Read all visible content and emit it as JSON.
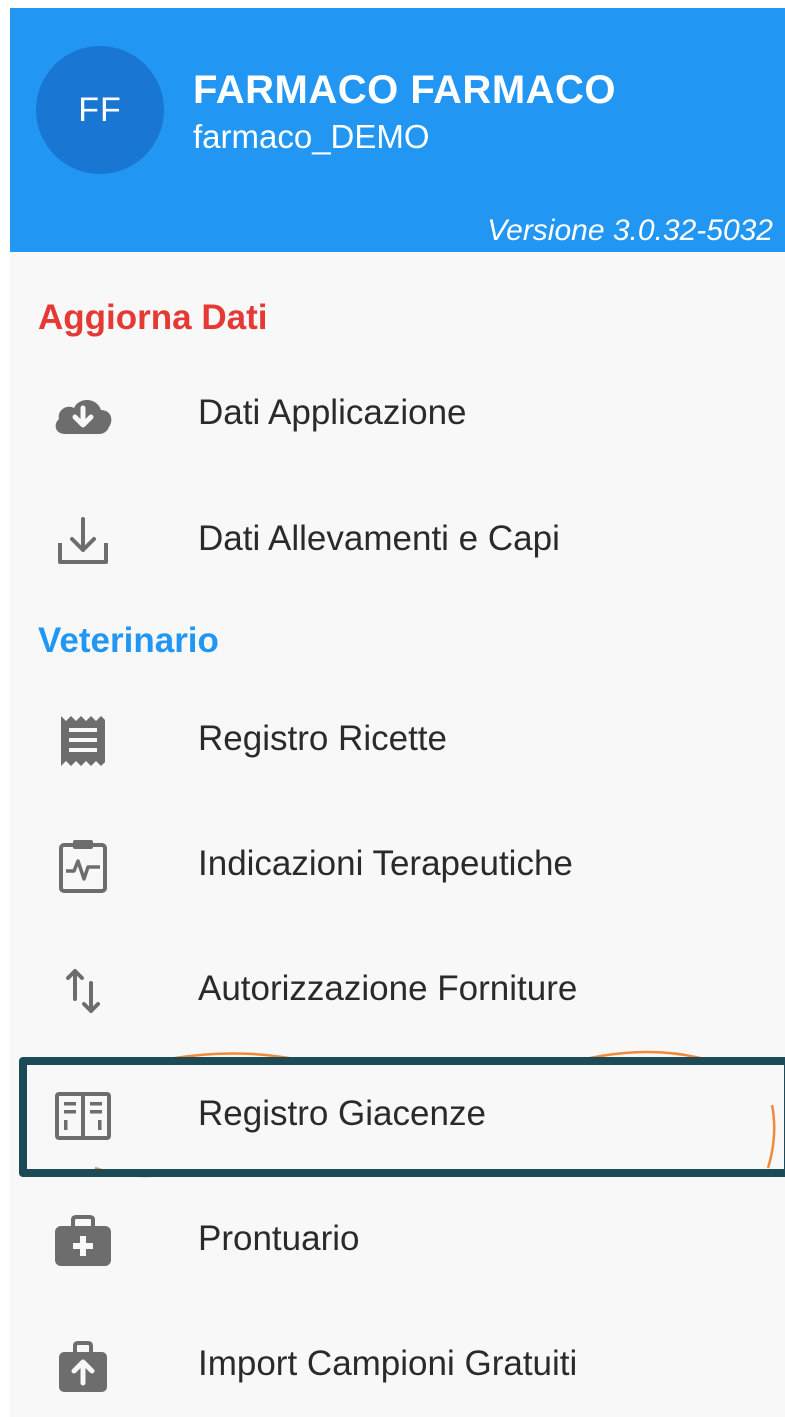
{
  "header": {
    "avatar_initials": "FF",
    "user_name": "FARMACO FARMACO",
    "user_id": "farmaco_DEMO",
    "version": "Versione 3.0.32-5032",
    "background_color": "#2196f3",
    "avatar_color": "#1976d2"
  },
  "sections": {
    "aggiorna": {
      "title": "Aggiorna Dati",
      "color": "#e53935",
      "items": [
        {
          "label": "Dati Applicazione",
          "icon": "cloud-download-icon"
        },
        {
          "label": "Dati Allevamenti e Capi",
          "icon": "tray-download-icon"
        }
      ]
    },
    "veterinario": {
      "title": "Veterinario",
      "color": "#2196f3",
      "items": [
        {
          "label": "Registro Ricette",
          "icon": "receipt-icon"
        },
        {
          "label": "Indicazioni Terapeutiche",
          "icon": "clipboard-pulse-icon"
        },
        {
          "label": "Autorizzazione Forniture",
          "icon": "swap-vertical-icon"
        },
        {
          "label": "Registro Giacenze",
          "icon": "book-ledger-icon"
        },
        {
          "label": "Prontuario",
          "icon": "medical-bag-icon"
        },
        {
          "label": "Import Campioni Gratuiti",
          "icon": "bag-upload-icon"
        }
      ]
    }
  },
  "highlight": {
    "target": "Registro Giacenze",
    "border_color": "#1c4a56",
    "accent_color": "#f08a3a"
  }
}
